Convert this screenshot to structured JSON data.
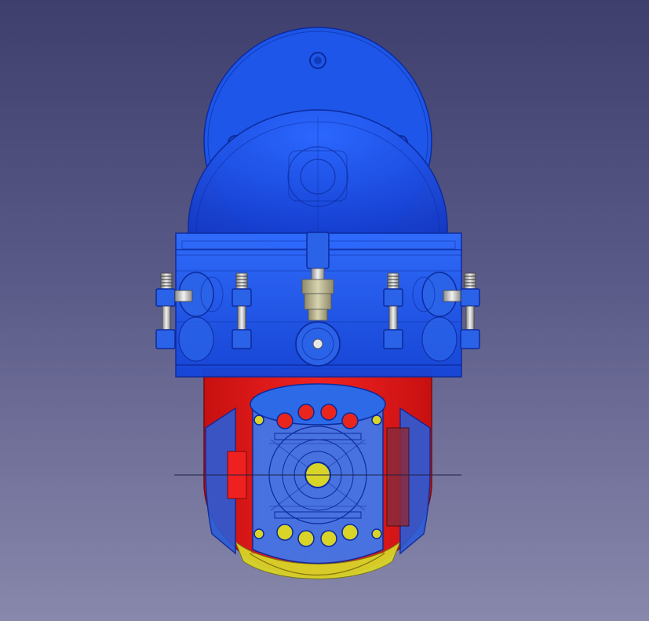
{
  "colors": {
    "background_top": "#3f3f6e",
    "background_bottom": "#8888ac",
    "blue_part": "#1a5af0",
    "blue_dark": "#0c2a9c",
    "red_part": "#e01818",
    "yellow_part": "#d8d428",
    "hardware": "#cfcfcf"
  }
}
